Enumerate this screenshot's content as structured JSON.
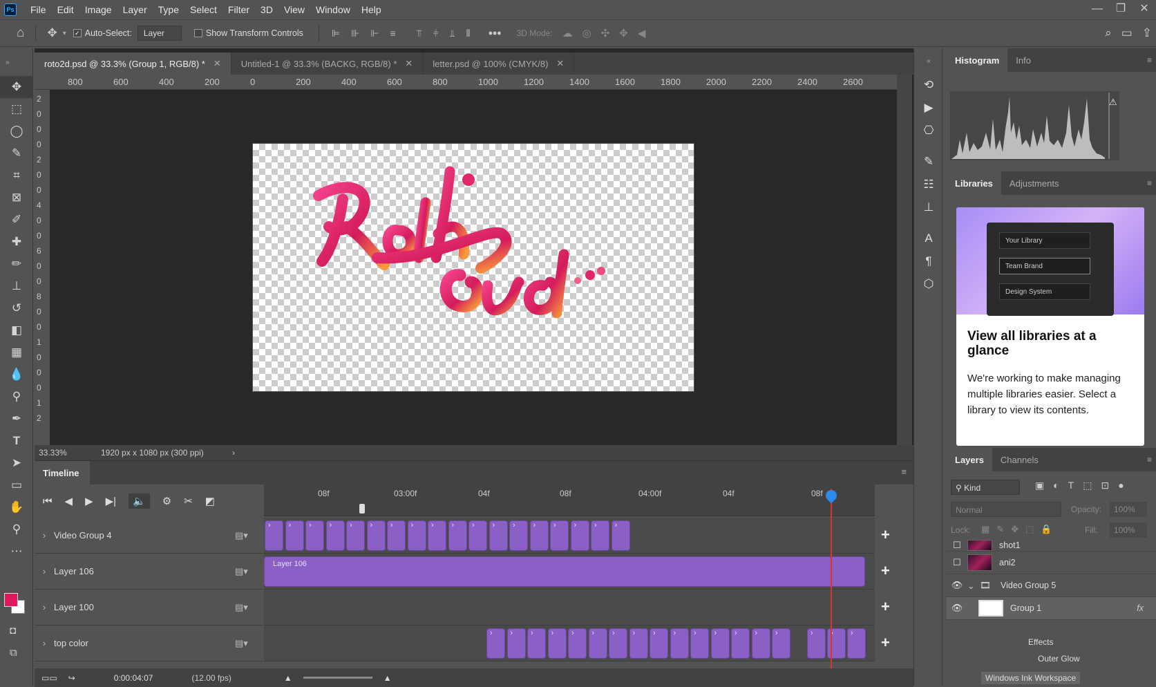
{
  "app": {
    "logo": "Ps",
    "menu": [
      "File",
      "Edit",
      "Image",
      "Layer",
      "Type",
      "Select",
      "Filter",
      "3D",
      "View",
      "Window",
      "Help"
    ]
  },
  "options": {
    "auto_select_label": "Auto-Select:",
    "auto_select_value": "Layer",
    "transform_label": "Show Transform Controls",
    "mode_3d": "3D Mode:"
  },
  "tabs": [
    {
      "label": "roto2d.psd @ 33.3% (Group 1, RGB/8) *"
    },
    {
      "label": "Untitled-1 @ 33.3% (BACKG, RGB/8) *"
    },
    {
      "label": "letter.psd @ 100% (CMYK/8)"
    }
  ],
  "ruler_h": [
    "800",
    "600",
    "400",
    "200",
    "0",
    "200",
    "400",
    "600",
    "800",
    "1000",
    "1200",
    "1400",
    "1600",
    "1800",
    "2000",
    "2200",
    "2400",
    "2600"
  ],
  "ruler_v": [
    "2",
    "0",
    "0",
    "0",
    "2",
    "0",
    "0",
    "4",
    "0",
    "0",
    "6",
    "0",
    "0",
    "8",
    "0",
    "0",
    "1",
    "0",
    "0",
    "0",
    "1",
    "2"
  ],
  "status": {
    "zoom": "33.33%",
    "size": "1920 px x 1080 px (300 ppi)"
  },
  "timeline": {
    "title": "Timeline",
    "timecode": "0:00:04:07",
    "fps": "(12.00 fps)",
    "marks": [
      "08f",
      "03:00f",
      "04f",
      "08f",
      "04:00f",
      "04f",
      "08f"
    ],
    "tracks": [
      {
        "name": "Video Group 4"
      },
      {
        "name": "Layer 106",
        "clip": "Layer 106"
      },
      {
        "name": "Layer 100"
      },
      {
        "name": "top color"
      }
    ]
  },
  "histogram": {
    "tabs": [
      "Histogram",
      "Info"
    ]
  },
  "libraries": {
    "tabs": [
      "Libraries",
      "Adjustments"
    ],
    "items": [
      "Your Library",
      "Team Brand",
      "Design System"
    ],
    "title": "View all libraries at a glance",
    "text": "We're working to make managing multiple libraries easier. Select a library to view its contents."
  },
  "layers": {
    "tabs": [
      "Layers",
      "Channels"
    ],
    "kind": "Kind",
    "blend": "Normal",
    "opacity_label": "Opacity:",
    "opacity": "100%",
    "lock_label": "Lock:",
    "fill_label": "Fill:",
    "fill": "100%",
    "rows": [
      "shot1",
      "ani2",
      "Video Group 5",
      "Group 1",
      "Effects",
      "Outer Glow"
    ],
    "watermark": "Windows Ink Workspace"
  },
  "colors": {
    "foreground": "#e0185a",
    "clip": "#8a5fc6",
    "playhead": "#e03030"
  }
}
